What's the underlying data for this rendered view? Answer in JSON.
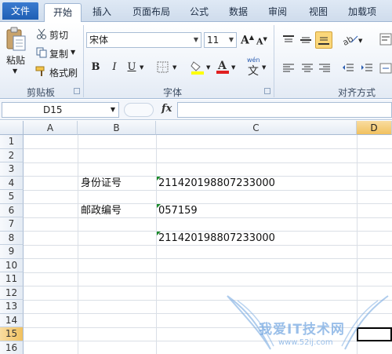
{
  "tabs": [
    {
      "label": "文件"
    },
    {
      "label": "开始"
    },
    {
      "label": "插入"
    },
    {
      "label": "页面布局"
    },
    {
      "label": "公式"
    },
    {
      "label": "数据"
    },
    {
      "label": "审阅"
    },
    {
      "label": "视图"
    },
    {
      "label": "加载项"
    }
  ],
  "ribbon": {
    "clipboard": {
      "paste": "粘贴",
      "cut": "剪切",
      "copy": "复制",
      "format_painter": "格式刷",
      "group": "剪贴板"
    },
    "font": {
      "name": "宋体",
      "size": "11",
      "bold": "B",
      "italic": "I",
      "underline": "U",
      "wen": "wén",
      "wen_char": "文",
      "group": "字体"
    },
    "alignment": {
      "group": "对齐方式"
    }
  },
  "formula_bar": {
    "name_box": "D15",
    "fx": "fx",
    "value": ""
  },
  "grid": {
    "columns": [
      "A",
      "B",
      "C",
      "D"
    ],
    "rows": [
      "1",
      "2",
      "3",
      "4",
      "5",
      "6",
      "7",
      "8",
      "9",
      "10",
      "11",
      "12",
      "13",
      "14",
      "15",
      "16"
    ],
    "selected_cell": "D15",
    "cells": {
      "B4": "身份证号",
      "C4": "211420198807233000",
      "B6": "邮政编号",
      "C6": "057159",
      "C8": "211420198807233000"
    }
  },
  "watermark": {
    "text": "我爱IT技术网",
    "url": "www.52ij.com"
  },
  "colors": {
    "file_tab": "#2a6cc4",
    "selection": "#f1c15f",
    "error_triangle": "#1a8a2a"
  }
}
